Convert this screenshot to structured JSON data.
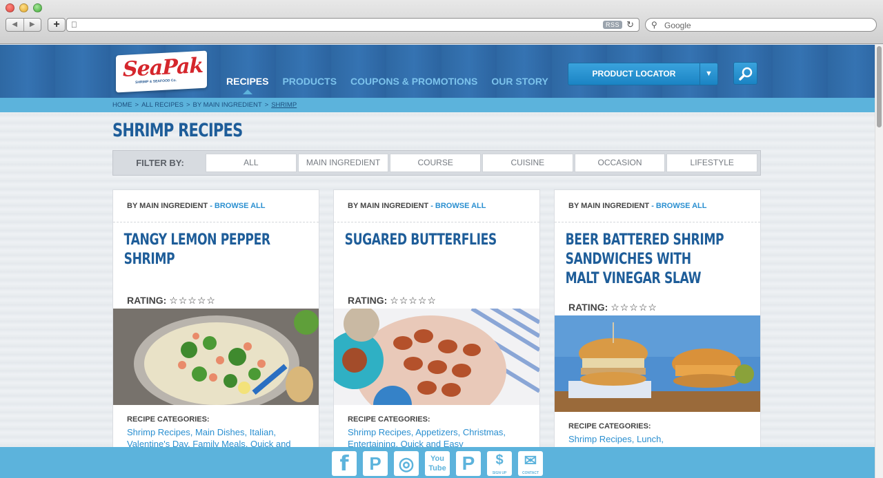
{
  "browser": {
    "rss_label": "RSS",
    "search_placeholder": "Google"
  },
  "site": {
    "logo_text": "SeaPak",
    "logo_sub": "SHRIMP & SEAFOOD Co.",
    "nav": [
      {
        "label": "RECIPES",
        "active": true
      },
      {
        "label": "PRODUCTS"
      },
      {
        "label": "COUPONS & PROMOTIONS"
      },
      {
        "label": "OUR STORY"
      }
    ],
    "locator_label": "PRODUCT LOCATOR"
  },
  "breadcrumb": [
    "HOME",
    "ALL RECIPES",
    "BY MAIN INGREDIENT",
    "SHRIMP"
  ],
  "page_title": "SHRIMP RECIPES",
  "filter": {
    "label": "FILTER BY:",
    "options": [
      "ALL",
      "MAIN INGREDIENT",
      "COURSE",
      "CUISINE",
      "OCCASION",
      "LIFESTYLE"
    ]
  },
  "cards": [
    {
      "head": "BY MAIN INGREDIENT",
      "browse": "- BROWSE ALL",
      "title": "TANGY LEMON PEPPER SHRIMP",
      "rating_label": "RATING:",
      "stars": "☆☆☆☆☆",
      "categories_label": "RECIPE CATEGORIES:",
      "categories": "Shrimp Recipes, Main Dishes, Italian, Valentine's Day, Family Meals, Quick and"
    },
    {
      "head": "BY MAIN INGREDIENT",
      "browse": "- BROWSE ALL",
      "title": "SUGARED BUTTERFLIES",
      "rating_label": "RATING:",
      "stars": "☆☆☆☆☆",
      "categories_label": "RECIPE CATEGORIES:",
      "categories": "Shrimp Recipes, Appetizers, Christmas, Entertaining, Quick and Easy"
    },
    {
      "head": "BY MAIN INGREDIENT",
      "browse": "- BROWSE ALL",
      "title": "BEER BATTERED SHRIMP SANDWICHES WITH MALT VINEGAR SLAW",
      "rating_label": "RATING:",
      "stars": "☆☆☆☆☆",
      "categories_label": "RECIPE CATEGORIES:",
      "categories": "Shrimp Recipes, Lunch,"
    }
  ],
  "social": [
    {
      "icon": "facebook-icon",
      "glyph": "f",
      "sub": ""
    },
    {
      "icon": "pinterest-icon",
      "glyph": "P",
      "sub": ""
    },
    {
      "icon": "instagram-icon",
      "glyph": "◎",
      "sub": ""
    },
    {
      "icon": "youtube-icon",
      "glyph": "You Tube",
      "sub": ""
    },
    {
      "icon": "pinterest-p-icon",
      "glyph": "P",
      "sub": ""
    },
    {
      "icon": "signup-icon",
      "glyph": "$",
      "sub": "SIGN UP"
    },
    {
      "icon": "contact-icon",
      "glyph": "✉",
      "sub": "CONTACT"
    }
  ]
}
